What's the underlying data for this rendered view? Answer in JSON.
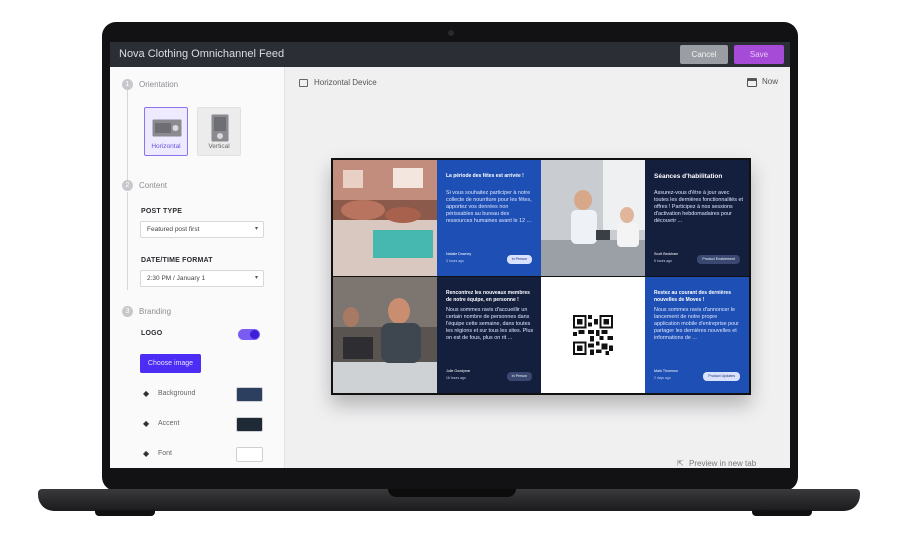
{
  "app": {
    "title": "Nova Clothing Omnichannel Feed",
    "cancel_label": "Cancel",
    "save_label": "Save"
  },
  "sidebar": {
    "steps": [
      {
        "number": "1",
        "label": "Orientation"
      },
      {
        "number": "2",
        "label": "Content"
      },
      {
        "number": "3",
        "label": "Branding"
      }
    ],
    "orientation": {
      "horizontal_label": "Horizontal",
      "vertical_label": "Vertical",
      "selected": "Horizontal"
    },
    "post_type": {
      "label": "POST TYPE",
      "value": "Featured post first"
    },
    "datetime_format": {
      "label": "DATE/TIME FORMAT",
      "value": "2:30 PM / January 1"
    },
    "logo": {
      "label": "LOGO",
      "enabled": true
    },
    "choose_image_label": "Choose image",
    "colors": [
      {
        "label": "Background",
        "value": "#2d3f5e"
      },
      {
        "label": "Accent",
        "value": "#1f2a37"
      },
      {
        "label": "Font",
        "value": "#ffffff"
      }
    ]
  },
  "preview": {
    "device_label": "Horizontal Device",
    "time_label": "Now",
    "open_link_label": "Preview in new tab",
    "posts": [
      {
        "title": "La période des fêtes est arrivée !",
        "body": "Si vous souhaitez participer à notre collecte de nourriture pour les fêtes, apportez vos denrées non périssables au bureau des ressources humaines avant le 12 ...",
        "author": "Natalie Downey",
        "time": "3 hours ago",
        "tag": "In Person"
      },
      {
        "title": "Séances d'habilitation",
        "body": "Assurez-vous d'être à jour avec toutes les dernières fonctionnalités et offres ! Participez à nos sessions d'activation hebdomadaires pour découvrir ...",
        "author": "Scott Beckham",
        "time": "5 hours ago",
        "tag": "Product Enablement"
      },
      {
        "title": "Rencontrez les nouveaux membres de notre équipe, en personne !",
        "body": "Nous sommes ravis d'accueillir un certain nombre de personnes dans l'équipe cette semaine, dans toutes les régions et sur tous les sites. Plus on est de fous, plus on rit ...",
        "author": "Julie Goodyear",
        "time": "16 hours ago",
        "tag": "In Person"
      },
      {
        "title": "Restez au courant des dernières nouvelles de Moves !",
        "body": "Nous sommes ravis d'annoncer le lancement de notre propre application mobile d'entreprise pour partager les dernières nouvelles et informations de ...",
        "author": "Mark Thomson",
        "time": "2 days ago",
        "tag": "Product Updates"
      }
    ]
  }
}
